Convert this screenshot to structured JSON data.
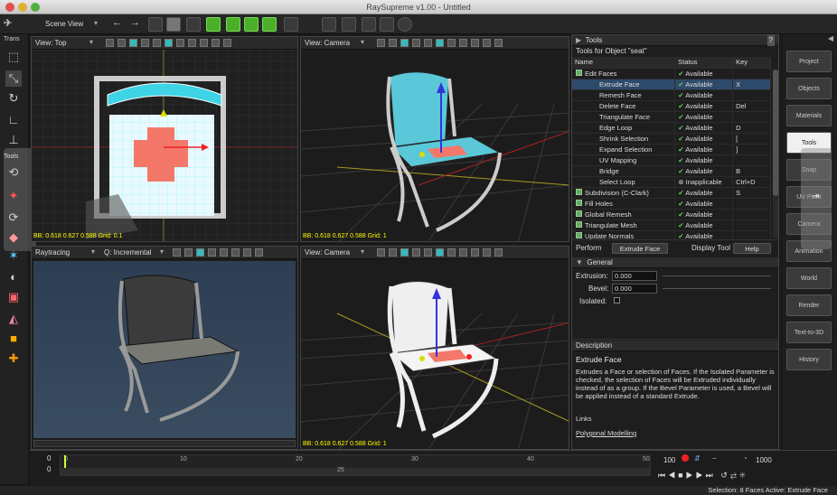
{
  "window": {
    "title": "RaySupreme v1.00 - Untitled"
  },
  "toolbar": {
    "scene_view": "Scene View"
  },
  "leftbar": {
    "trans_label": "Trans",
    "tools_label": "Tools"
  },
  "viewports": {
    "top_left": {
      "label": "View: Top",
      "footer": "BB: 0.618 0.627 0.588  Grid: 0.1"
    },
    "top_right": {
      "label": "View: Camera",
      "footer": "BB: 0.618 0.627 0.588  Grid: 1"
    },
    "bottom_left": {
      "label": "Raytracing",
      "quality_label": "Q: Incremental"
    },
    "bottom_right": {
      "label": "View: Camera",
      "footer": "BB: 0.618 0.627 0.588  Grid: 1"
    }
  },
  "tools_panel": {
    "title": "Tools",
    "subtitle": "Tools for Object \"seat\"",
    "columns": [
      "Name",
      "Status",
      "Key"
    ],
    "rows": [
      {
        "name": "Edit Faces",
        "status": "Available",
        "key": "",
        "indent": 0
      },
      {
        "name": "Extrude Face",
        "status": "Available",
        "key": "X",
        "indent": 1,
        "selected": true
      },
      {
        "name": "Remesh Face",
        "status": "Available",
        "key": "",
        "indent": 1
      },
      {
        "name": "Delete Face",
        "status": "Available",
        "key": "Del",
        "indent": 1
      },
      {
        "name": "Triangulate Face",
        "status": "Available",
        "key": "",
        "indent": 1
      },
      {
        "name": "Edge Loop",
        "status": "Available",
        "key": "D",
        "indent": 1
      },
      {
        "name": "Shrink Selection",
        "status": "Available",
        "key": "[",
        "indent": 1
      },
      {
        "name": "Expand Selection",
        "status": "Available",
        "key": "]",
        "indent": 1
      },
      {
        "name": "UV Mapping",
        "status": "Available",
        "key": "",
        "indent": 1
      },
      {
        "name": "Bridge",
        "status": "Available",
        "key": "B",
        "indent": 1
      },
      {
        "name": "Select Loop",
        "status": "Inapplicable",
        "key": "Ctrl+D",
        "indent": 1
      },
      {
        "name": "Subdivision (C-Clark)",
        "status": "Available",
        "key": "S",
        "indent": 0
      },
      {
        "name": "Fill Holes",
        "status": "Available",
        "key": "",
        "indent": 0
      },
      {
        "name": "Global Remesh",
        "status": "Available",
        "key": "",
        "indent": 0
      },
      {
        "name": "Triangulate Mesh",
        "status": "Available",
        "key": "",
        "indent": 0
      },
      {
        "name": "Update Normals",
        "status": "Available",
        "key": "",
        "indent": 0
      }
    ],
    "perform_label": "Perform",
    "perform_button": "Extrude Face",
    "display_tool_label": "Display Tool",
    "help_button": "Help",
    "general_header": "General",
    "extrusion_label": "Extrusion:",
    "extrusion_value": "0.000",
    "bevel_label": "Bevel:",
    "bevel_value": "0.000",
    "isolated_label": "Isolated:",
    "description_header": "Description",
    "description_title": "Extrude Face",
    "description_text": "Extrudes a Face or selection of Faces. If the Isolated Parameter is checked, the selection of Faces will be Extruded individually instead of as a group. If the Bevel Parameter is used, a Bevel will be applied instead of a standard Extrude.",
    "links_label": "Links",
    "link_text": "Polygonal Modelling"
  },
  "right_tabs": [
    "Project",
    "Objects",
    "Materials",
    "Tools",
    "Snap",
    "UV Paint",
    "Camera",
    "Animation",
    "World",
    "Render",
    "Text-to-3D",
    "History"
  ],
  "active_tab": "Tools",
  "timeline": {
    "ticks": [
      "0",
      "10",
      "20",
      "30",
      "40",
      "50"
    ],
    "start_top": "0",
    "start_bottom": "0",
    "mid_label": "25",
    "end_frame": "100",
    "fps_value": "1000"
  },
  "status": {
    "text": "Selection: 8 Faces  Active: Extrude Face"
  }
}
